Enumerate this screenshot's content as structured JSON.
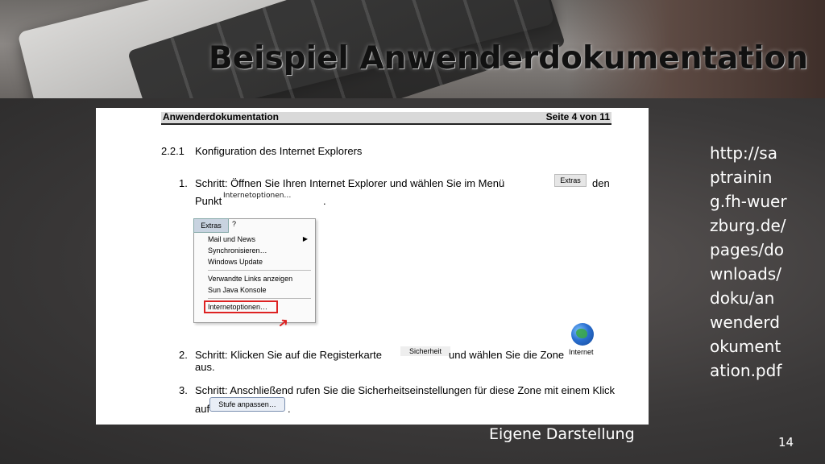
{
  "slide": {
    "title": "Beispiel Anwenderdokumentation",
    "source_url": "http://saptraining.fh-wuerzburg.de/pages/downloads/doku/anwenderdokumentation.pdf",
    "caption": "Eigene Darstellung",
    "page_number": "14"
  },
  "document": {
    "header_left": "Anwenderdokumentation",
    "header_right": "Seite 4 von 11",
    "section_number": "2.2.1",
    "section_title": "Konfiguration des Internet Explorers",
    "steps": [
      {
        "number": "1.",
        "line1": "Schritt:  Öffnen  Sie  Ihren  Internet  Explorer  und  wählen  Sie  im  Menü",
        "line1_end": "den",
        "line2": "Punkt",
        "line2_end": "."
      },
      {
        "number": "2.",
        "line1": "Schritt: Klicken Sie auf die Registerkarte",
        "line1_end": "und wählen Sie die Zone",
        "line2": "aus."
      },
      {
        "number": "3.",
        "line1": "Schritt: Anschließend rufen Sie die Sicherheitseinstellungen für diese Zone mit einem Klick",
        "line2": "auf",
        "line2_end": "."
      }
    ],
    "inline": {
      "extras_button": "Extras",
      "internetoptionen_label": "Internetoptionen…",
      "sicherheit_tab": "Sicherheit",
      "internet_zone": "Internet",
      "stufe_button": "Stufe anpassen…"
    },
    "menu": {
      "menubar": [
        "Extras",
        "?"
      ],
      "items_group1": [
        "Mail und News",
        "Synchronisieren…",
        "Windows Update"
      ],
      "items_group2": [
        "Verwandte Links anzeigen",
        "Sun Java Konsole"
      ],
      "highlighted_item": "Internetoptionen…"
    }
  }
}
